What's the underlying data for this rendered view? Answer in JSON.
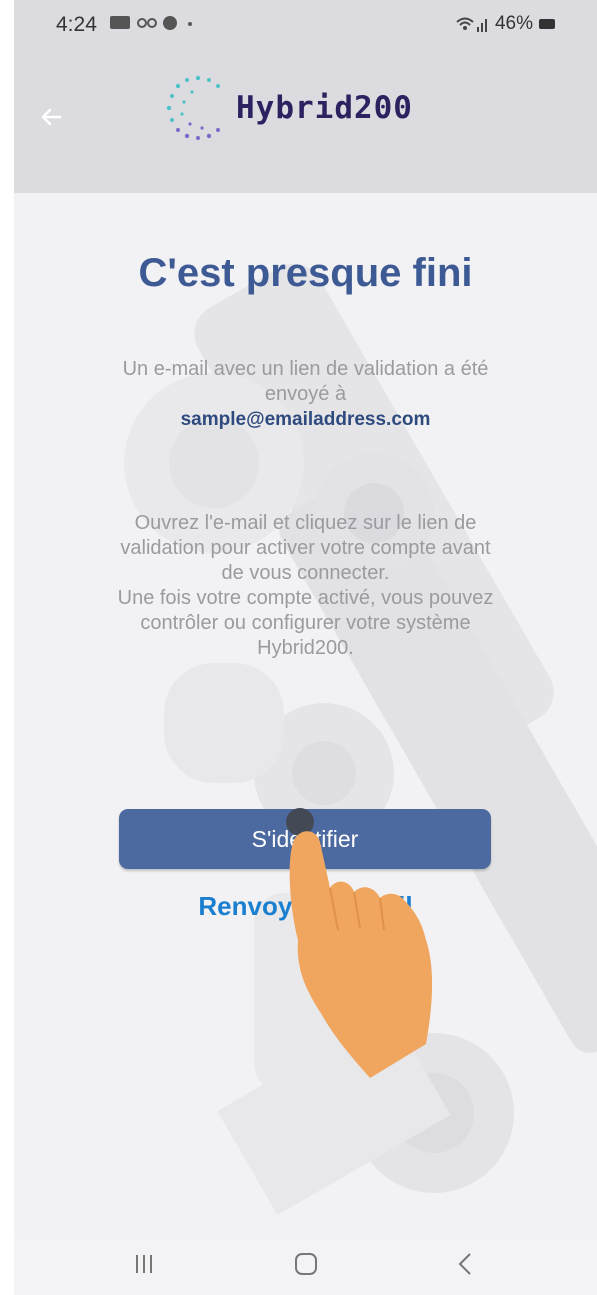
{
  "status_bar": {
    "time": "4:24",
    "left_icons": "ⓓ ·· ● •",
    "battery_percent": "46%"
  },
  "header": {
    "app_name": "Hybrid200"
  },
  "main": {
    "title": "C'est presque fini",
    "intro_line1": "Un e-mail avec un lien de validation a été",
    "intro_line2": "envoyé à",
    "email": "sample@emailaddress.com",
    "instructions": [
      "Ouvrez l'e-mail et cliquez sur le lien de",
      "validation pour activer votre compte avant",
      "de vous connecter.",
      "Une fois votre compte activé, vous pouvez",
      "contrôler ou configurer votre système",
      "Hybrid200."
    ],
    "login_button": "S'identifier",
    "resend_link": "Renvoyer l'e-mail"
  },
  "colors": {
    "header_bg": "#dcdce0",
    "title": "#3d5a94",
    "button": "#4d6aa0",
    "link": "#1b7fd0",
    "logo_text": "#2d2260"
  }
}
